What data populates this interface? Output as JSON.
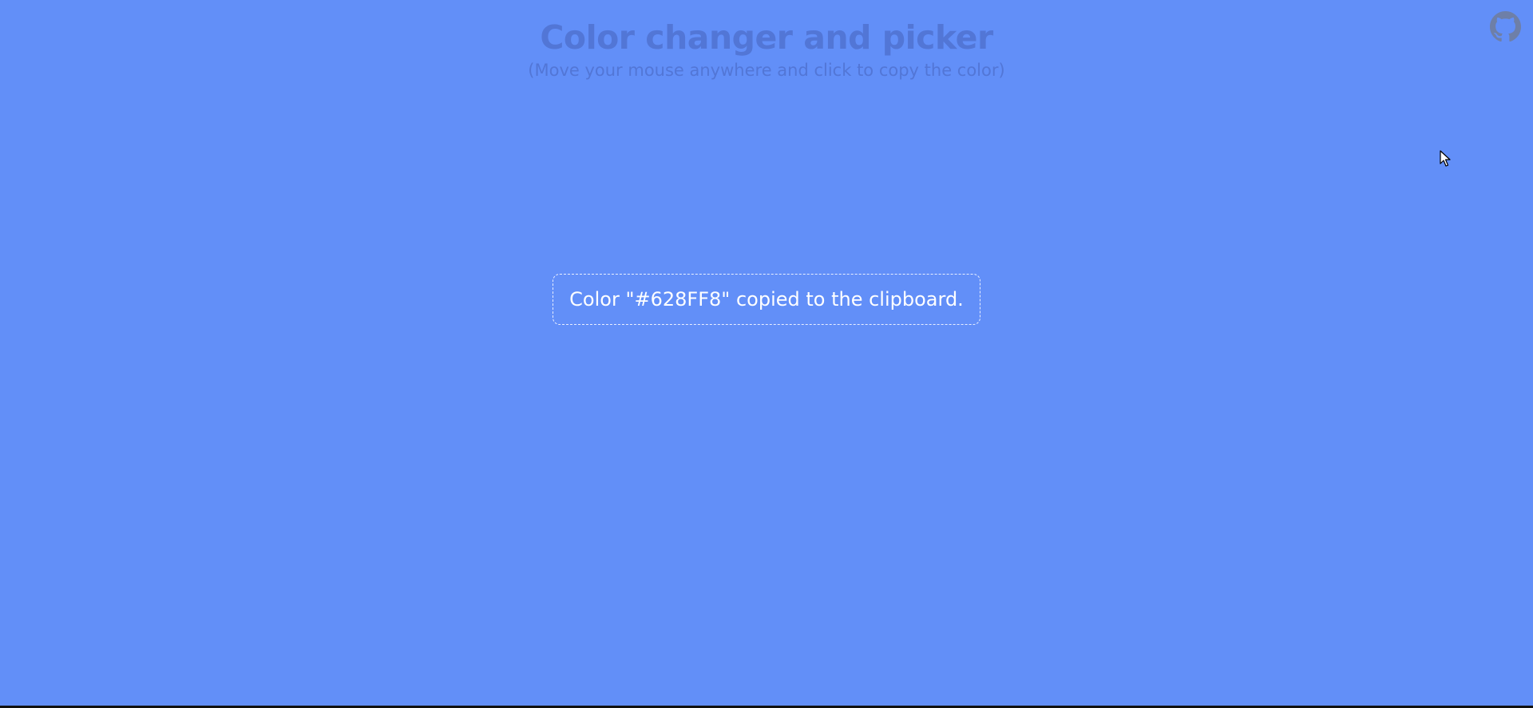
{
  "header": {
    "title": "Color changer and picker",
    "subtitle": "(Move your mouse anywhere and click to copy the color)"
  },
  "toast": {
    "message": "Color \"#628FF8\" copied to the clipboard."
  },
  "github_link": {
    "icon": "github-icon"
  },
  "colors": {
    "background": "#628FF8",
    "heading_text": "#5276D6",
    "toast_text": "#FFFFFF",
    "github_icon": "#6E7FA8"
  }
}
